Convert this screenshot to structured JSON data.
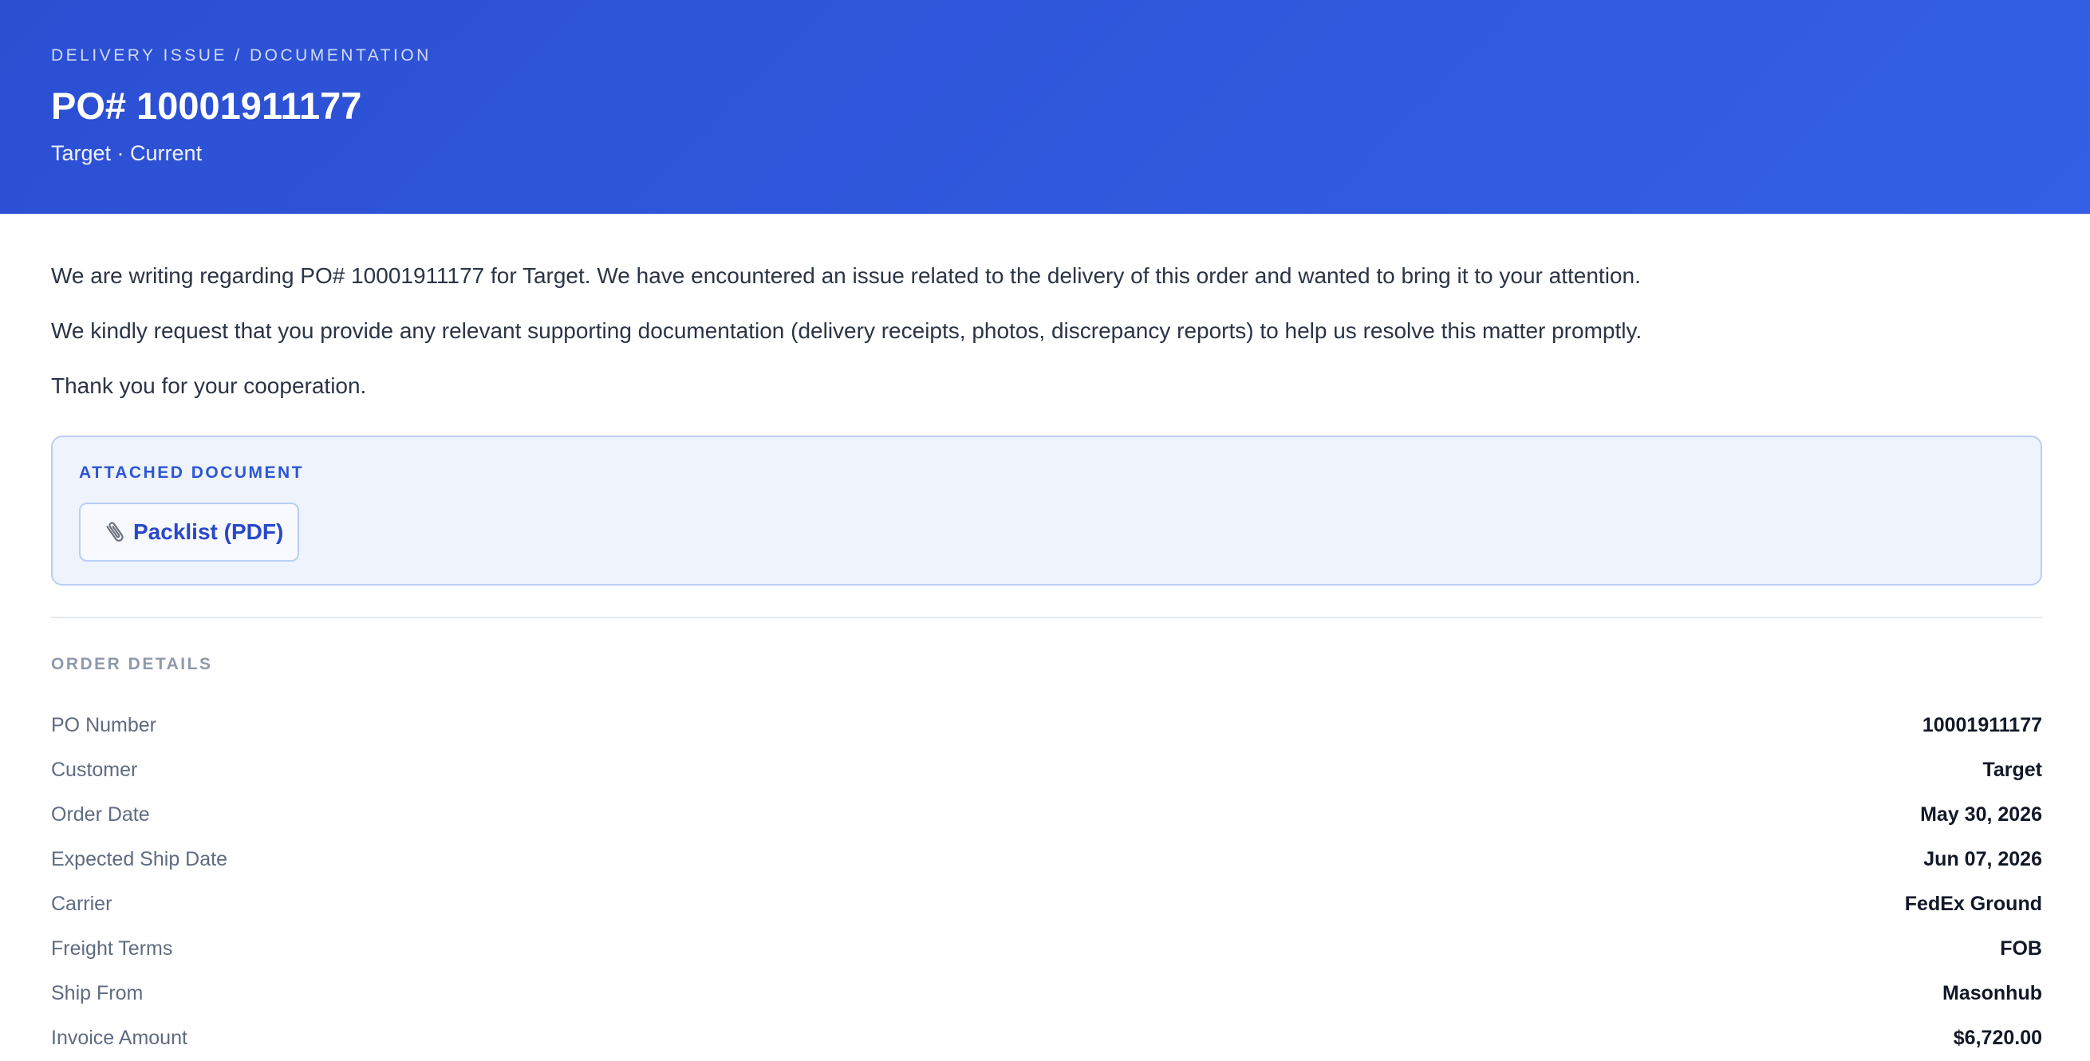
{
  "header": {
    "eyebrow": "DELIVERY ISSUE / DOCUMENTATION",
    "title": "PO# 10001911177",
    "subtitle": "Target · Current"
  },
  "body": {
    "paragraph1": "We are writing regarding PO# 10001911177 for Target. We have encountered an issue related to the delivery of this order and wanted to bring it to your attention.",
    "paragraph2": "We kindly request that you provide any relevant supporting documentation (delivery receipts, photos, discrepancy reports) to help us resolve this matter promptly.",
    "paragraph3": "Thank you for your cooperation."
  },
  "attachment": {
    "label": "ATTACHED DOCUMENT",
    "icon": "paperclip-icon",
    "button_label": "Packlist (PDF)"
  },
  "order_details": {
    "label": "ORDER DETAILS",
    "rows": [
      {
        "label": "PO Number",
        "value": "10001911177"
      },
      {
        "label": "Customer",
        "value": "Target"
      },
      {
        "label": "Order Date",
        "value": "May 30, 2026"
      },
      {
        "label": "Expected Ship Date",
        "value": "Jun 07, 2026"
      },
      {
        "label": "Carrier",
        "value": "FedEx Ground"
      },
      {
        "label": "Freight Terms",
        "value": "FOB"
      },
      {
        "label": "Ship From",
        "value": "Masonhub"
      },
      {
        "label": "Invoice Amount",
        "value": "$6,720.00"
      }
    ]
  },
  "colors": {
    "header_bg_start": "#2c4fd2",
    "header_bg_end": "#3360e4",
    "accent": "#2d55d4",
    "attachment_bg": "#eef3fc",
    "attachment_border": "#b9cff3"
  }
}
